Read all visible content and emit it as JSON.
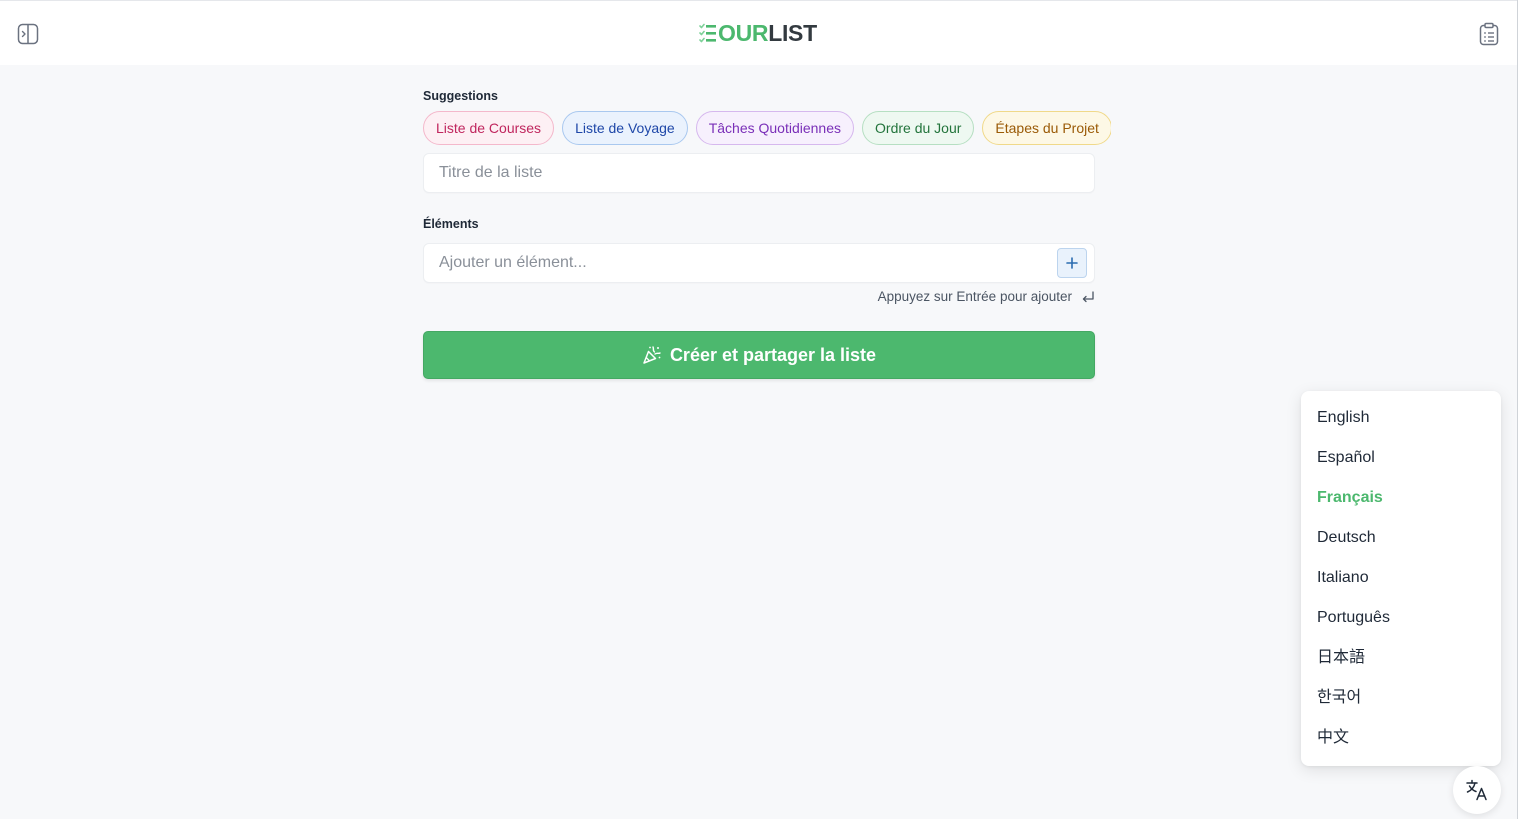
{
  "header": {
    "logo_part1": "OUR",
    "logo_part2": "LIST",
    "sidebar_icon": "sidebar-toggle-icon",
    "clipboard_icon": "clipboard-list-icon"
  },
  "suggestions": {
    "label": "Suggestions",
    "chips": [
      {
        "label": "Liste de Courses",
        "color": "#c0265e",
        "bg": "#fdf0f4",
        "border": "#f4b8cb"
      },
      {
        "label": "Liste de Voyage",
        "color": "#1e47a8",
        "bg": "#eaf2fd",
        "border": "#a9c8ef"
      },
      {
        "label": "Tâches Quotidiennes",
        "color": "#7a2fb8",
        "bg": "#f7f0fd",
        "border": "#d6b8ee"
      },
      {
        "label": "Ordre du Jour",
        "color": "#23743c",
        "bg": "#eef8f1",
        "border": "#b6dfc2"
      },
      {
        "label": "Étapes du Projet",
        "color": "#9a5a07",
        "bg": "#fdf8e6",
        "border": "#f0d98a"
      }
    ]
  },
  "list_title": {
    "placeholder": "Titre de la liste",
    "value": ""
  },
  "items": {
    "label": "Éléments",
    "placeholder": "Ajouter un élément...",
    "add_icon": "plus-icon",
    "hint": "Appuyez sur Entrée pour ajouter",
    "hint_icon": "enter-return-icon"
  },
  "create_button": {
    "label": "Créer et partager la liste",
    "icon": "party-popper-icon"
  },
  "language_menu": {
    "options": [
      "English",
      "Español",
      "Français",
      "Deutsch",
      "Italiano",
      "Português",
      "日本語",
      "한국어",
      "中文"
    ],
    "selected": "Français"
  },
  "translate_button": {
    "icon": "translate-icon"
  },
  "colors": {
    "accent": "#4cb86e",
    "background": "#f7f8fa"
  }
}
